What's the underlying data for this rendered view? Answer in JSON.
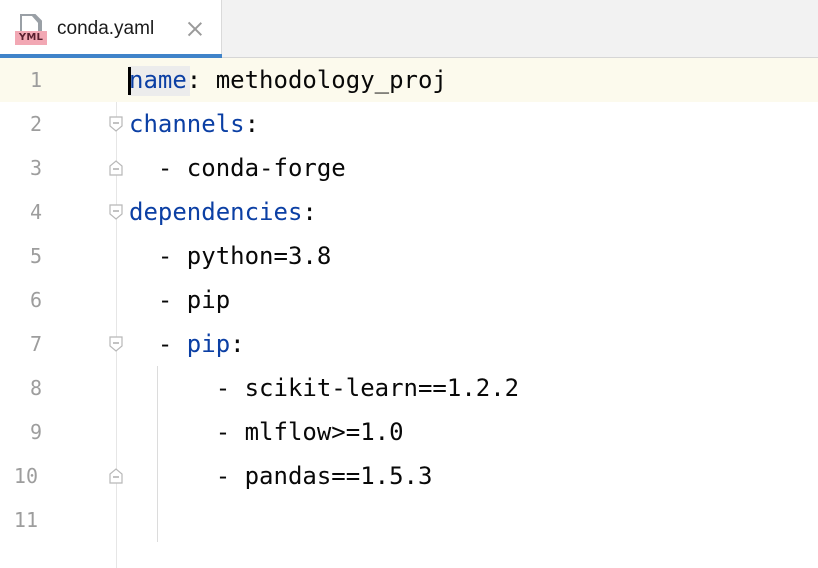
{
  "tab": {
    "file_icon_label": "YML",
    "title": "conda.yaml"
  },
  "editor": {
    "lines": [
      {
        "num": "1",
        "key": "name",
        "rest": ": methodology_proj"
      },
      {
        "num": "2",
        "key": "channels",
        "rest": ":"
      },
      {
        "num": "3",
        "text": "  - conda-forge"
      },
      {
        "num": "4",
        "key": "dependencies",
        "rest": ":"
      },
      {
        "num": "5",
        "text": "  - python=3.8"
      },
      {
        "num": "6",
        "text": "  - pip"
      },
      {
        "num": "7",
        "prefix": "  - ",
        "key": "pip",
        "rest": ":"
      },
      {
        "num": "8",
        "text": "      - scikit-learn==1.2.2"
      },
      {
        "num": "9",
        "text": "      - mlflow>=1.0"
      },
      {
        "num": "10",
        "text": "      - pandas==1.5.3"
      },
      {
        "num": "11",
        "text": ""
      }
    ]
  },
  "colors": {
    "key": "#0b3fa4",
    "text": "#080808",
    "line_number": "#9d9d9d",
    "current_line": "#fcfaed",
    "tab_underline": "#4083c9",
    "yml_badge": "#f2a8b4"
  }
}
